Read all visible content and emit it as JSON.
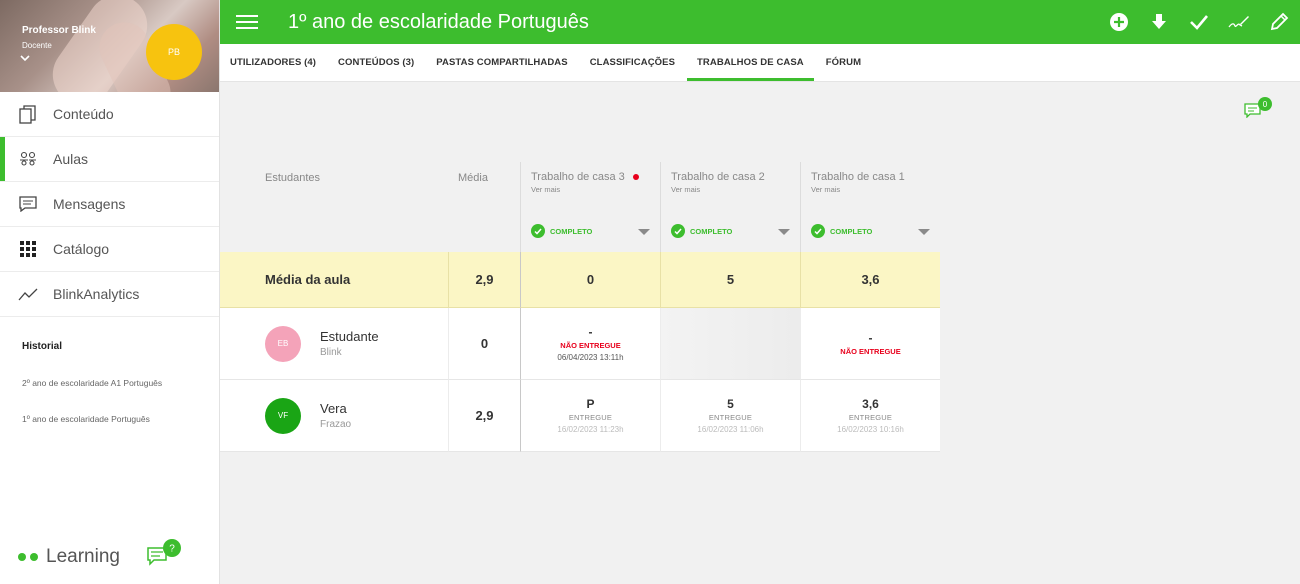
{
  "sidebar": {
    "profile": {
      "name": "Professor Blink",
      "role": "Docente",
      "avatar_initials": "PB",
      "avatar_color": "#f7c30f"
    },
    "nav": [
      {
        "label": "Conteúdo",
        "icon": "book-icon"
      },
      {
        "label": "Aulas",
        "icon": "users-icon",
        "active": true
      },
      {
        "label": "Mensagens",
        "icon": "message-icon"
      },
      {
        "label": "Catálogo",
        "icon": "grid-icon"
      },
      {
        "label": "BlinkAnalytics",
        "icon": "analytics-icon"
      }
    ],
    "history": {
      "title": "Historial",
      "items": [
        "2º ano de escolaridade A1 Português",
        "1º ano de escolaridade  Português"
      ]
    },
    "brand": {
      "text": "Learning",
      "help_count": "?"
    }
  },
  "topbar": {
    "title": "1º ano de escolaridade Português",
    "accent": "#3dbd2e",
    "actions": [
      "plus-circle-icon",
      "download-icon",
      "check-icon",
      "signature-icon",
      "pencil-icon"
    ]
  },
  "tabs": [
    "UTILIZADORES (4)",
    "CONTEÚDOS (3)",
    "PASTAS COMPARTILHADAS",
    "CLASSIFICAÇÕES",
    "TRABALHOS DE CASA",
    "FÓRUM"
  ],
  "active_tab": "TRABALHOS DE CASA",
  "chat": {
    "count": "0"
  },
  "grades": {
    "headers": {
      "students": "Estudantes",
      "average": "Média"
    },
    "homeworks": [
      {
        "title": "Trabalho de casa 3",
        "more": "Ver mais",
        "status": "COMPLETO",
        "new": true
      },
      {
        "title": "Trabalho de casa 2",
        "more": "Ver mais",
        "status": "COMPLETO",
        "new": false
      },
      {
        "title": "Trabalho de casa 1",
        "more": "Ver mais",
        "status": "COMPLETO",
        "new": false
      }
    ],
    "class_average": {
      "label": "Média da aula",
      "average": "2,9",
      "values": [
        "0",
        "5",
        "3,6"
      ]
    },
    "students": [
      {
        "first": "Estudante",
        "last": "Blink",
        "initials": "EB",
        "avatar_color": "#f4a3b9",
        "average": "0",
        "grades": [
          {
            "value": "-",
            "status": "NÃO ENTREGUE",
            "date": "06/04/2023 13:11h"
          },
          {
            "value": "",
            "status": "",
            "date": ""
          },
          {
            "value": "-",
            "status": "NÃO ENTREGUE",
            "date": ""
          }
        ]
      },
      {
        "first": "Vera",
        "last": "Frazao",
        "initials": "VF",
        "avatar_color": "#1aa515",
        "average": "2,9",
        "grades": [
          {
            "value": "P",
            "status": "ENTREGUE",
            "date": "16/02/2023 11:23h"
          },
          {
            "value": "5",
            "status": "ENTREGUE",
            "date": "16/02/2023 11:06h"
          },
          {
            "value": "3,6",
            "status": "ENTREGUE",
            "date": "16/02/2023 10:16h"
          }
        ]
      }
    ]
  }
}
